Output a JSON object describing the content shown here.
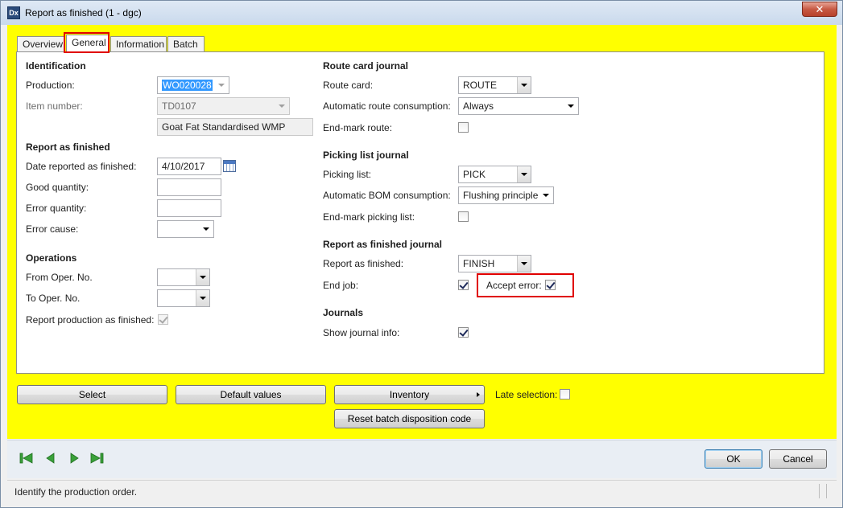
{
  "window": {
    "title": "Report as finished (1 - dgc)",
    "close_glyph": "✕",
    "app_icon_glyph": "Dx"
  },
  "tabs": [
    {
      "label": "Overview"
    },
    {
      "label": "General"
    },
    {
      "label": "Information"
    },
    {
      "label": "Batch"
    }
  ],
  "identification": {
    "section": "Identification",
    "production_label": "Production:",
    "production_value": "WO020028",
    "item_number_label": "Item number:",
    "item_number_value": "TD0107",
    "item_name": "Goat Fat Standardised WMP"
  },
  "report_as_finished": {
    "section": "Report as finished",
    "date_label": "Date reported as finished:",
    "date_value": "4/10/2017",
    "good_qty_label": "Good quantity:",
    "good_qty_value": "",
    "error_qty_label": "Error quantity:",
    "error_qty_value": "",
    "error_cause_label": "Error cause:",
    "error_cause_value": ""
  },
  "operations": {
    "section": "Operations",
    "from_label": "From Oper. No.",
    "from_value": "",
    "to_label": "To Oper. No.",
    "to_value": "",
    "report_prod_label": "Report production as finished:",
    "report_prod_checked": true
  },
  "route_card_journal": {
    "section": "Route card journal",
    "route_card_label": "Route card:",
    "route_card_value": "ROUTE",
    "auto_route_label": "Automatic route consumption:",
    "auto_route_value": "Always",
    "end_mark_route_label": "End-mark route:",
    "end_mark_route_checked": false
  },
  "picking_list_journal": {
    "section": "Picking list journal",
    "picking_list_label": "Picking list:",
    "picking_list_value": "PICK",
    "auto_bom_label": "Automatic BOM consumption:",
    "auto_bom_value": "Flushing principle",
    "end_mark_picking_label": "End-mark picking list:",
    "end_mark_picking_checked": false
  },
  "report_as_finished_journal": {
    "section": "Report as finished journal",
    "raf_label": "Report as finished:",
    "raf_value": "FINISH",
    "end_job_label": "End job:",
    "end_job_checked": true,
    "accept_error_label": "Accept error:",
    "accept_error_checked": true
  },
  "journals": {
    "section": "Journals",
    "show_info_label": "Show journal info:",
    "show_info_checked": true
  },
  "actions": {
    "select": "Select",
    "default_values": "Default values",
    "inventory": "Inventory",
    "reset_batch": "Reset batch disposition code",
    "late_selection_label": "Late selection:",
    "late_selection_checked": false
  },
  "footer": {
    "ok": "OK",
    "cancel": "Cancel"
  },
  "status": {
    "text": "Identify the production order."
  },
  "colors": {
    "background": "#ffff00",
    "highlight": "#e00000",
    "nav_green": "#3aa13a"
  }
}
